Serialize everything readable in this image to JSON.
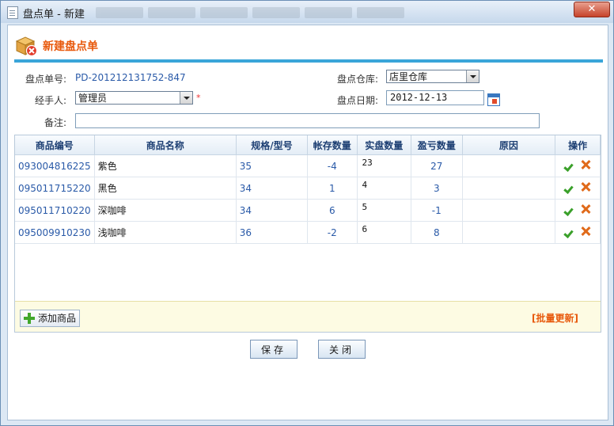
{
  "window": {
    "title": "盘点单 - 新建",
    "close": "✕"
  },
  "header": {
    "title": "新建盘点单"
  },
  "form": {
    "order_no_label": "盘点单号:",
    "order_no": "PD-201212131752-847",
    "warehouse_label": "盘点仓库:",
    "warehouse": "店里仓库",
    "handler_label": "经手人:",
    "handler": "管理员",
    "required_mark": "*",
    "date_label": "盘点日期:",
    "date": "2012-12-13",
    "remark_label": "备注:",
    "remark": ""
  },
  "table": {
    "headers": [
      "商品编号",
      "商品名称",
      "规格/型号",
      "帐存数量",
      "实盘数量",
      "盈亏数量",
      "原因",
      "操作"
    ],
    "rows": [
      {
        "code": "093004816225",
        "name": "紫色",
        "spec": "35",
        "book_qty": "-4",
        "actual_qty": "23",
        "diff": "27",
        "reason": ""
      },
      {
        "code": "095011715220",
        "name": "黑色",
        "spec": "34",
        "book_qty": "1",
        "actual_qty": "4",
        "diff": "3",
        "reason": ""
      },
      {
        "code": "095011710220",
        "name": "深咖啡",
        "spec": "34",
        "book_qty": "6",
        "actual_qty": "5",
        "diff": "-1",
        "reason": ""
      },
      {
        "code": "095009910230",
        "name": "浅咖啡",
        "spec": "36",
        "book_qty": "-2",
        "actual_qty": "6",
        "diff": "8",
        "reason": ""
      }
    ]
  },
  "footer": {
    "add_label": "添加商品",
    "batch_label": "[批量更新]"
  },
  "buttons": {
    "save": "保存",
    "close": "关闭"
  },
  "icons": [
    "document-icon",
    "box-delete-icon",
    "calendar-icon",
    "confirm-check-icon",
    "delete-x-icon",
    "plus-icon"
  ],
  "colors": {
    "accent": "#e8590c",
    "header_bar": "#3aa5d9",
    "link": "#2a5aa8"
  }
}
